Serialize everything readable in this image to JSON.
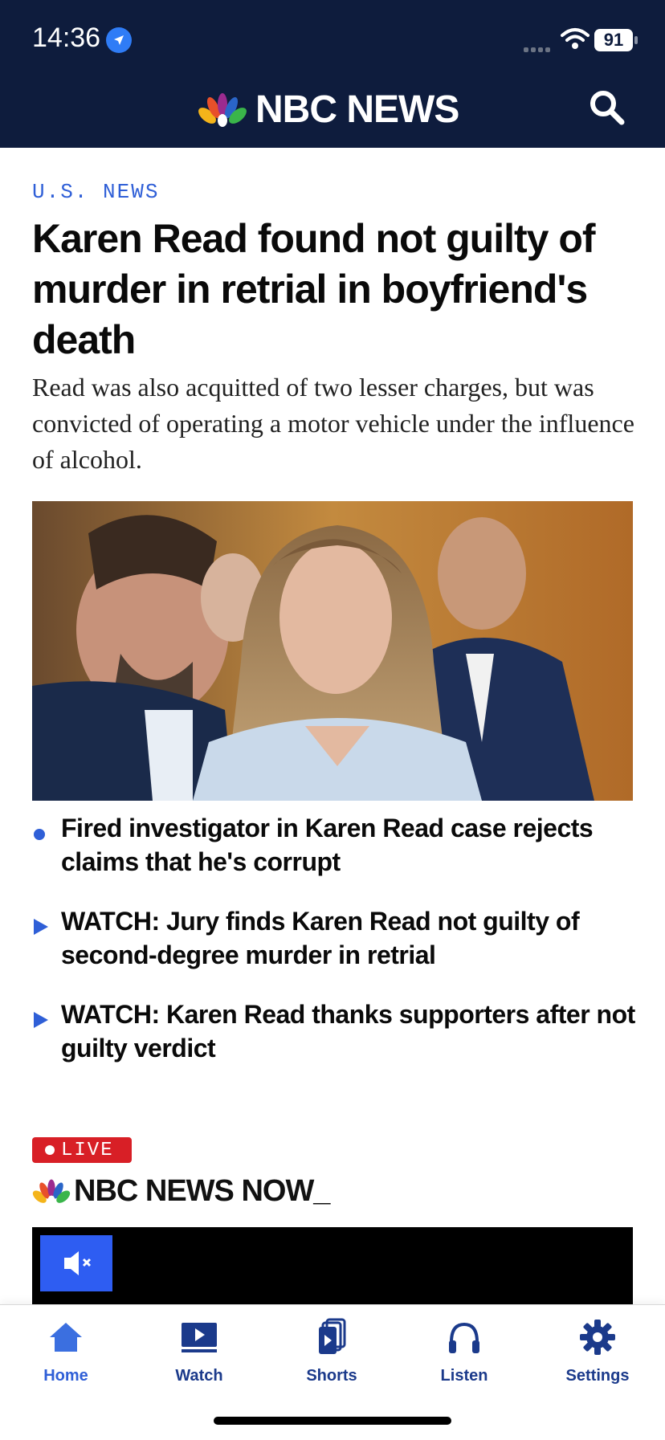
{
  "status_bar": {
    "time": "14:36",
    "battery": "91"
  },
  "header": {
    "brand": "NBC NEWS"
  },
  "article": {
    "kicker": "U.S. NEWS",
    "headline": "Karen Read found not guilty of murder in retrial in boyfriend's death",
    "dek": "Read was also acquitted of two lesser charges, but was convicted of operating a motor vehicle under the influence of alcohol."
  },
  "related": [
    {
      "type": "article",
      "text": "Fired investigator in Karen Read case rejects claims that he's corrupt"
    },
    {
      "type": "video",
      "text": "WATCH: Jury finds Karen Read not guilty of second-degree murder in retrial"
    },
    {
      "type": "video",
      "text": "WATCH: Karen Read thanks supporters after not guilty verdict"
    }
  ],
  "live": {
    "badge": "LIVE",
    "brand": "NBC NEWS NOW_"
  },
  "tabs": {
    "home": "Home",
    "watch": "Watch",
    "shorts": "Shorts",
    "listen": "Listen",
    "settings": "Settings"
  },
  "colors": {
    "header_bg": "#0e1c3d",
    "accent": "#2f5fd7",
    "live_red": "#d81f26"
  }
}
